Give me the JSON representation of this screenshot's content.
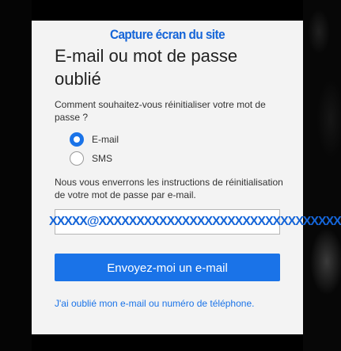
{
  "caption": "Capture écran du site",
  "form": {
    "title": "E-mail ou mot de passe oublié",
    "question": "Comment souhaitez-vous réinitialiser votre mot de passe ?",
    "options": [
      {
        "label": "E-mail",
        "selected": true
      },
      {
        "label": "SMS",
        "selected": false
      }
    ],
    "info": "Nous vous enverrons les instructions de réinitialisation de votre mot de passe par e-mail.",
    "email_value": "XXXXX@XXXXXXXXXXXXXXXXXXXXXXXXXXXXXXXXX",
    "submit_label": "Envoyez-moi un e-mail",
    "forgot_link": "J'ai oublié mon e-mail ou numéro de téléphone."
  },
  "colors": {
    "accent": "#1a73e8",
    "caption": "#1565d8",
    "panel_bg": "#f3f3f3",
    "page_bg": "#000000"
  }
}
